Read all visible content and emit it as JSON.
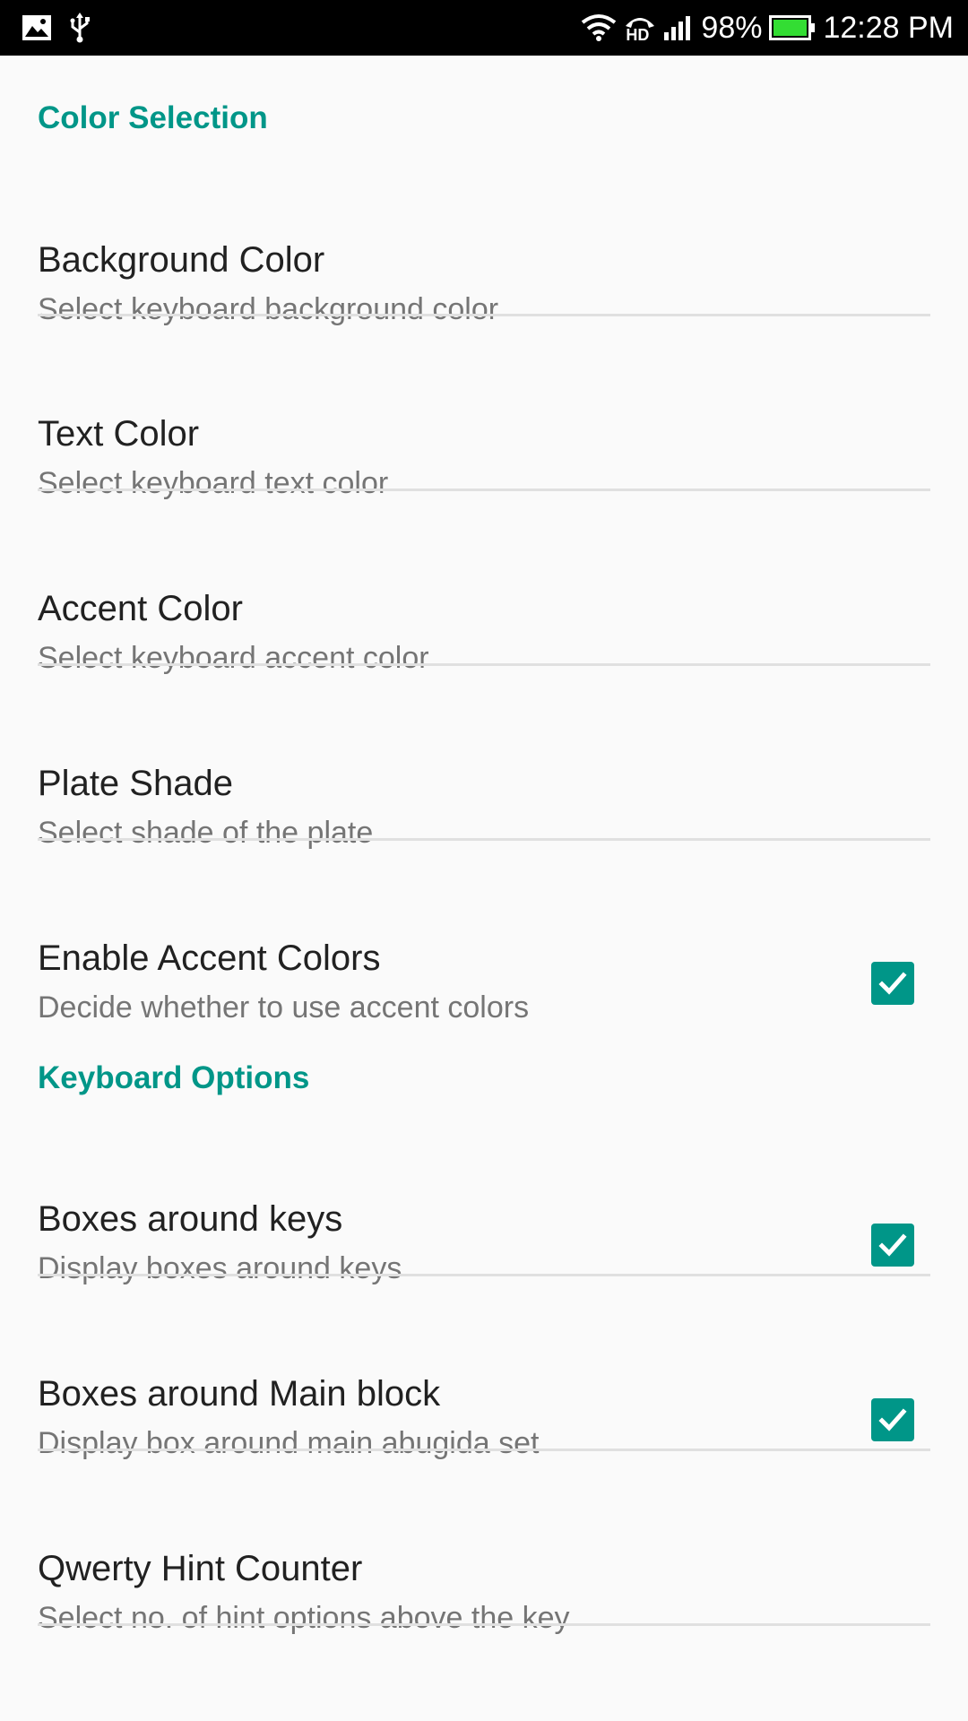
{
  "status_bar": {
    "battery": "98%",
    "time": "12:28 PM",
    "network_label": "HD",
    "icons": [
      "image-icon",
      "usb-icon",
      "wifi-icon",
      "hd-call-icon",
      "signal-icon",
      "battery-icon"
    ],
    "battery_color": "#33dd33"
  },
  "colors": {
    "accent": "#009688",
    "title": "#212121",
    "summary": "#757575",
    "background": "#fafafa"
  },
  "sections": {
    "color_selection": {
      "header": "Color Selection",
      "items": [
        {
          "title": "Background Color",
          "summary": "Select keyboard background color"
        },
        {
          "title": "Text Color",
          "summary": "Select keyboard text color"
        },
        {
          "title": "Accent Color",
          "summary": "Select keyboard accent color"
        },
        {
          "title": "Plate Shade",
          "summary": "Select shade of the plate"
        },
        {
          "title": "Enable Accent Colors",
          "summary": "Decide whether to use accent colors",
          "checked": true
        }
      ]
    },
    "keyboard_options": {
      "header": "Keyboard Options",
      "items": [
        {
          "title": "Boxes around keys",
          "summary": "Display boxes around keys",
          "checked": true
        },
        {
          "title": "Boxes around Main block",
          "summary": "Display box around main abugida set",
          "checked": true
        },
        {
          "title": "Qwerty Hint Counter",
          "summary": "Select no. of hint options above the key"
        }
      ]
    }
  }
}
